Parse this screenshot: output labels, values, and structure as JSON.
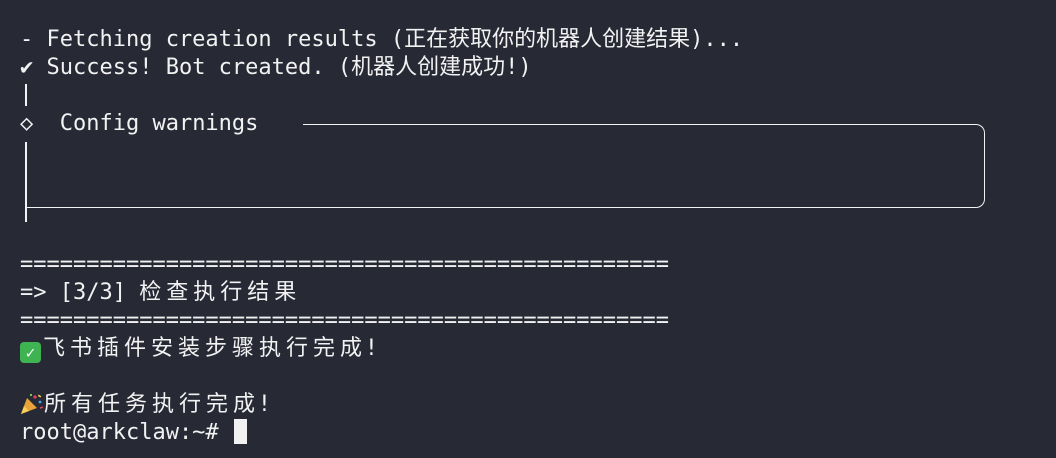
{
  "terminal": {
    "lines": {
      "fetching": "- Fetching creation results (正在获取你的机器人创建结果)...",
      "success_mark": "✔",
      "success": " Success! Bot created. (机器人创建成功!)",
      "config_diamond": "◇",
      "config_title": "  Config warnings ",
      "separator": "=================================================",
      "step": "=> [3/3] ",
      "step_cjk": "检查执行结果",
      "plugin_done": "飞书插件安装步骤执行完成!",
      "all_done": "所有任务执行完成!",
      "prompt": "root@arkclaw:~# "
    },
    "icons": {
      "check": "white-check-mark-icon",
      "party": "party-popper-icon"
    },
    "colors": {
      "background": "#272935",
      "foreground": "#f2f2f2",
      "check_green": "#3fb351"
    }
  }
}
